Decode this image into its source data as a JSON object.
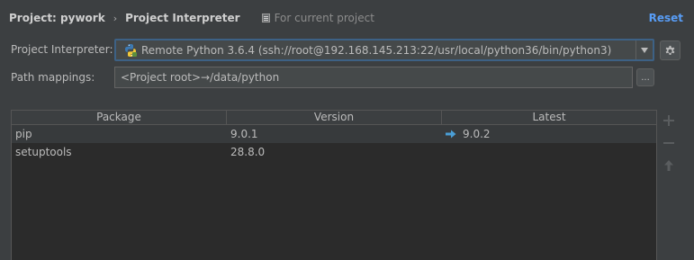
{
  "header": {
    "breadcrumb_project": "Project: pywork",
    "breadcrumb_separator": "›",
    "breadcrumb_page": "Project Interpreter",
    "scope_text": "For current project",
    "reset_label": "Reset"
  },
  "interpreter": {
    "label": "Project Interpreter:",
    "value": "Remote Python 3.6.4 (ssh://root@192.168.145.213:22/usr/local/python36/bin/python3)",
    "icon": "python-icon"
  },
  "path_mappings": {
    "label": "Path mappings:",
    "value": "<Project root>→/data/python",
    "browse_label": "..."
  },
  "packages": {
    "columns": [
      "Package",
      "Version",
      "Latest"
    ],
    "rows": [
      {
        "package": "pip",
        "version": "9.0.1",
        "latest": "9.0.2",
        "upgrade_available": true
      },
      {
        "package": "setuptools",
        "version": "28.8.0",
        "latest": "",
        "upgrade_available": false
      }
    ]
  },
  "side_toolbar": {
    "icons": [
      "add-icon",
      "remove-icon",
      "upgrade-icon"
    ]
  },
  "colors": {
    "background": "#3c3f41",
    "table_background": "#2b2b2b",
    "accent": "#589df6",
    "focus_border": "#3d6185",
    "upgrade_arrow": "#4a9ed6"
  }
}
